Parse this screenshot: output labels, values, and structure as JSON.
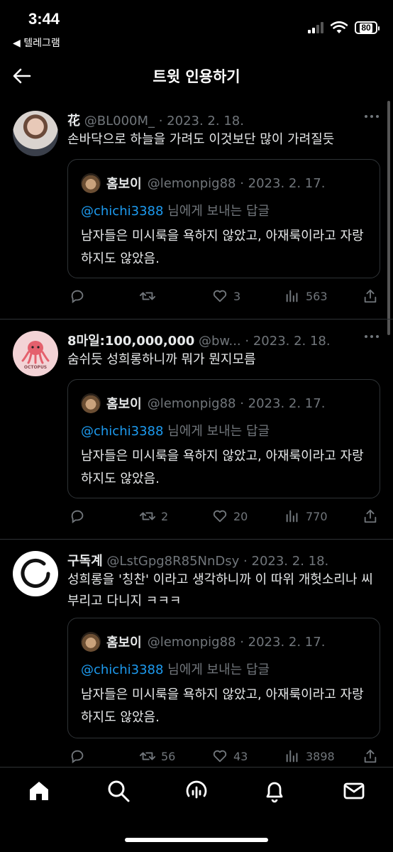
{
  "status_bar": {
    "time": "3:44",
    "back_app": "◀ 텔레그램",
    "battery": "80"
  },
  "header": {
    "title": "트윗 인용하기"
  },
  "tweets": [
    {
      "name": "花",
      "handle": "@BL000M_",
      "date": "· 2023. 2. 18.",
      "text": "손바닥으로 하늘을 가려도 이것보단 많이 가려질듯",
      "quote": {
        "name": "홈보이",
        "handle": "@lemonpig88 · 2023. 2. 17.",
        "mention": "@chichi3388",
        "reply_suffix": " 님에게 보내는 답글",
        "text": "남자들은 미시룩을 욕하지 않았고, 아재룩이라고 자랑 하지도 않았음."
      },
      "stats": {
        "retweets": "",
        "likes": "3",
        "views": "563"
      }
    },
    {
      "name": "8마일:100,000,000",
      "handle": "@bw...",
      "date": "· 2023. 2. 18.",
      "text": "숨쉬듯 성희롱하니까 뭐가 뭔지모름",
      "avatar_label": "OCTOPUS",
      "quote": {
        "name": "홈보이",
        "handle": "@lemonpig88 · 2023. 2. 17.",
        "mention": "@chichi3388",
        "reply_suffix": " 님에게 보내는 답글",
        "text": "남자들은 미시룩을 욕하지 않았고, 아재룩이라고 자랑 하지도 않았음."
      },
      "stats": {
        "retweets": "2",
        "likes": "20",
        "views": "770"
      }
    },
    {
      "name": "구독계",
      "handle": "@LstGpg8R85NnDsy",
      "date": "· 2023. 2. 18.",
      "text": "성희롱을 '칭찬' 이라고 생각하니까 이 따위 개헛소리나 씨부리고 다니지 ㅋㅋㅋ",
      "quote": {
        "name": "홈보이",
        "handle": "@lemonpig88 · 2023. 2. 17.",
        "mention": "@chichi3388",
        "reply_suffix": " 님에게 보내는 답글",
        "text": "남자들은 미시룩을 욕하지 않았고, 아재룩이라고 자랑 하지도 않았음."
      },
      "stats": {
        "retweets": "56",
        "likes": "43",
        "views": "3898"
      }
    }
  ],
  "colors": {
    "background": "#000000",
    "mention": "#1d9bf0",
    "muted": "#71767b",
    "border": "#2f3336"
  },
  "nav_icons": [
    "home-icon",
    "search-icon",
    "spaces-icon",
    "notifications-icon",
    "messages-icon"
  ]
}
